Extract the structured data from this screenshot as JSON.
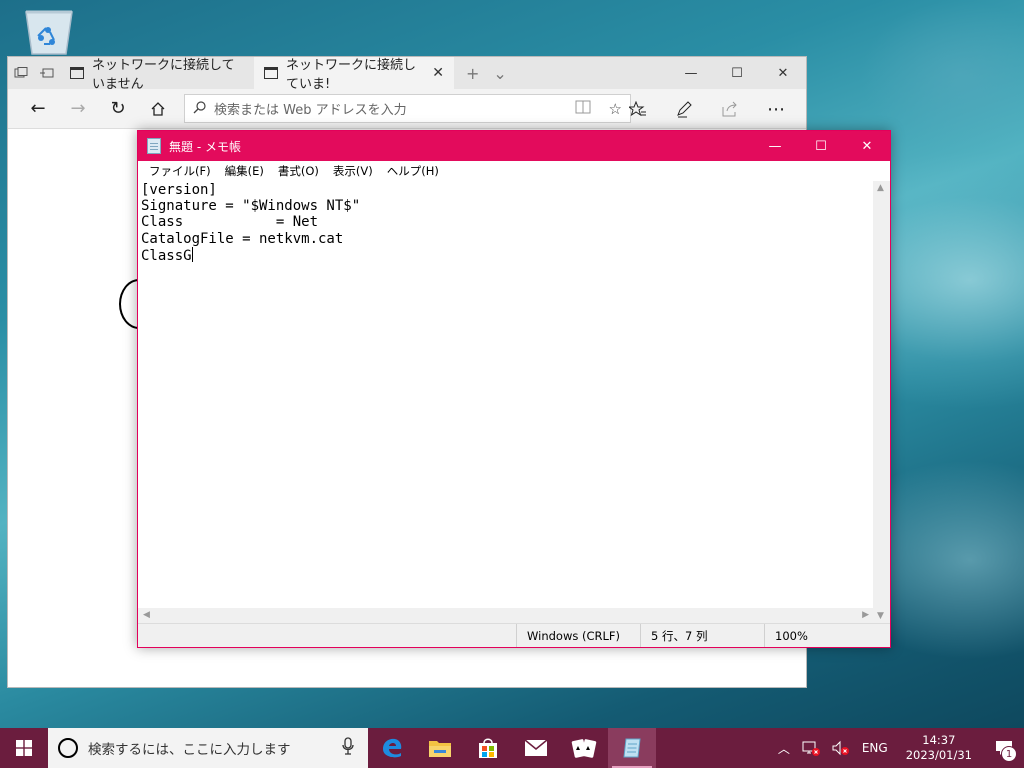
{
  "edge": {
    "tabs": [
      {
        "label": "ネットワークに接続していません"
      },
      {
        "label": "ネットワークに接続していま!"
      }
    ],
    "address_placeholder": "検索または Web アドレスを入力"
  },
  "notepad": {
    "title": "無題 - メモ帳",
    "menu": [
      "ファイル(F)",
      "編集(E)",
      "書式(O)",
      "表示(V)",
      "ヘルプ(H)"
    ],
    "lines": [
      "[version]",
      "Signature = \"$Windows NT$\"",
      "Class           = Net",
      "CatalogFile = netkvm.cat",
      "ClassG"
    ],
    "status": {
      "encoding": "Windows (CRLF)",
      "position": "5 行、7 列",
      "zoom": "100%"
    }
  },
  "taskbar": {
    "search_placeholder": "検索するには、ここに入力します",
    "language": "ENG",
    "time": "14:37",
    "date": "2023/01/31",
    "notification_count": "1"
  }
}
